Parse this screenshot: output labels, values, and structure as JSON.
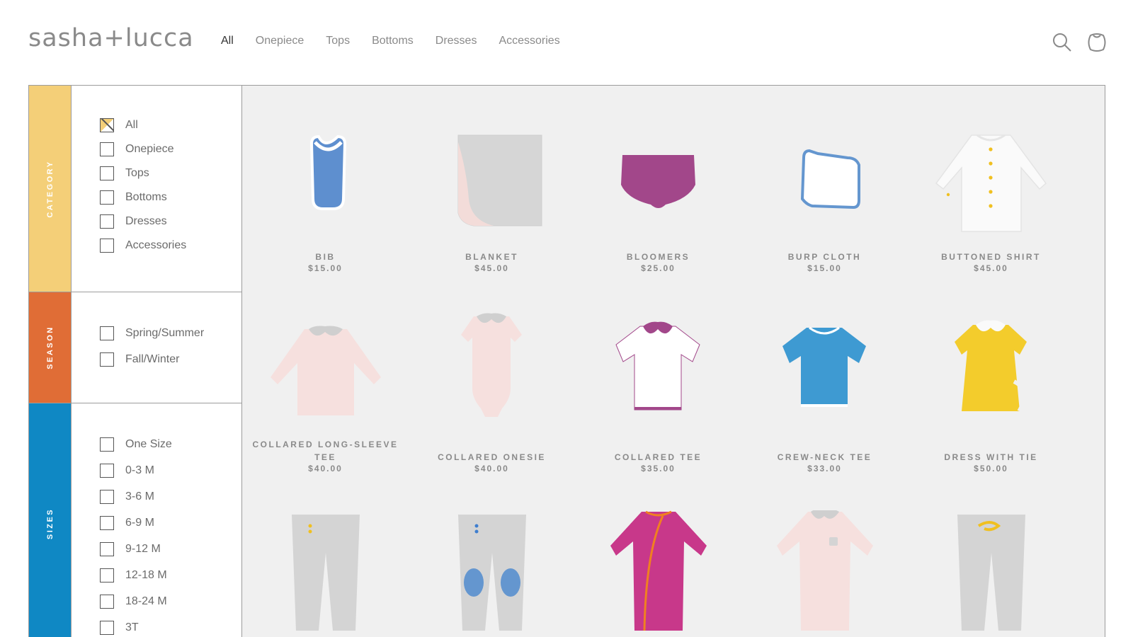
{
  "header": {
    "logo": "sasha+lucca",
    "nav": [
      {
        "label": "All",
        "active": true
      },
      {
        "label": "Onepiece",
        "active": false
      },
      {
        "label": "Tops",
        "active": false
      },
      {
        "label": "Bottoms",
        "active": false
      },
      {
        "label": "Dresses",
        "active": false
      },
      {
        "label": "Accessories",
        "active": false
      }
    ],
    "icons": [
      "search-icon",
      "bag-icon"
    ]
  },
  "filters": {
    "category": {
      "title": "CATEGORY",
      "color": "#f4cf78",
      "options": [
        {
          "label": "All",
          "checked": true
        },
        {
          "label": "Onepiece",
          "checked": false
        },
        {
          "label": "Tops",
          "checked": false
        },
        {
          "label": "Bottoms",
          "checked": false
        },
        {
          "label": "Dresses",
          "checked": false
        },
        {
          "label": "Accessories",
          "checked": false
        }
      ]
    },
    "season": {
      "title": "SEASON",
      "color": "#e06d36",
      "options": [
        {
          "label": "Spring/Summer",
          "checked": false
        },
        {
          "label": "Fall/Winter",
          "checked": false
        }
      ]
    },
    "sizes": {
      "title": "SIZES",
      "color": "#0f88c4",
      "options": [
        {
          "label": "One Size",
          "checked": false
        },
        {
          "label": "0-3 M",
          "checked": false
        },
        {
          "label": "3-6 M",
          "checked": false
        },
        {
          "label": "6-9 M",
          "checked": false
        },
        {
          "label": "9-12 M",
          "checked": false
        },
        {
          "label": "12-18 M",
          "checked": false
        },
        {
          "label": "18-24 M",
          "checked": false
        },
        {
          "label": "3T",
          "checked": false
        }
      ]
    }
  },
  "products": [
    {
      "name": "BIB",
      "price": "$15.00"
    },
    {
      "name": "BLANKET",
      "price": "$45.00"
    },
    {
      "name": "BLOOMERS",
      "price": "$25.00"
    },
    {
      "name": "BURP CLOTH",
      "price": "$15.00"
    },
    {
      "name": "BUTTONED SHIRT",
      "price": "$45.00"
    },
    {
      "name": "COLLARED LONG-SLEEVE TEE",
      "price": "$40.00"
    },
    {
      "name": "COLLARED ONESIE",
      "price": "$40.00"
    },
    {
      "name": "COLLARED TEE",
      "price": "$35.00"
    },
    {
      "name": "CREW-NECK TEE",
      "price": "$33.00"
    },
    {
      "name": "DRESS WITH TIE",
      "price": "$50.00"
    },
    {
      "name": "",
      "price": ""
    },
    {
      "name": "",
      "price": ""
    },
    {
      "name": "",
      "price": ""
    },
    {
      "name": "",
      "price": ""
    },
    {
      "name": "",
      "price": ""
    }
  ],
  "colors": {
    "grid_bg": "#f0f0f0",
    "border": "#9c9c9c",
    "text": "#8a8a8a"
  }
}
